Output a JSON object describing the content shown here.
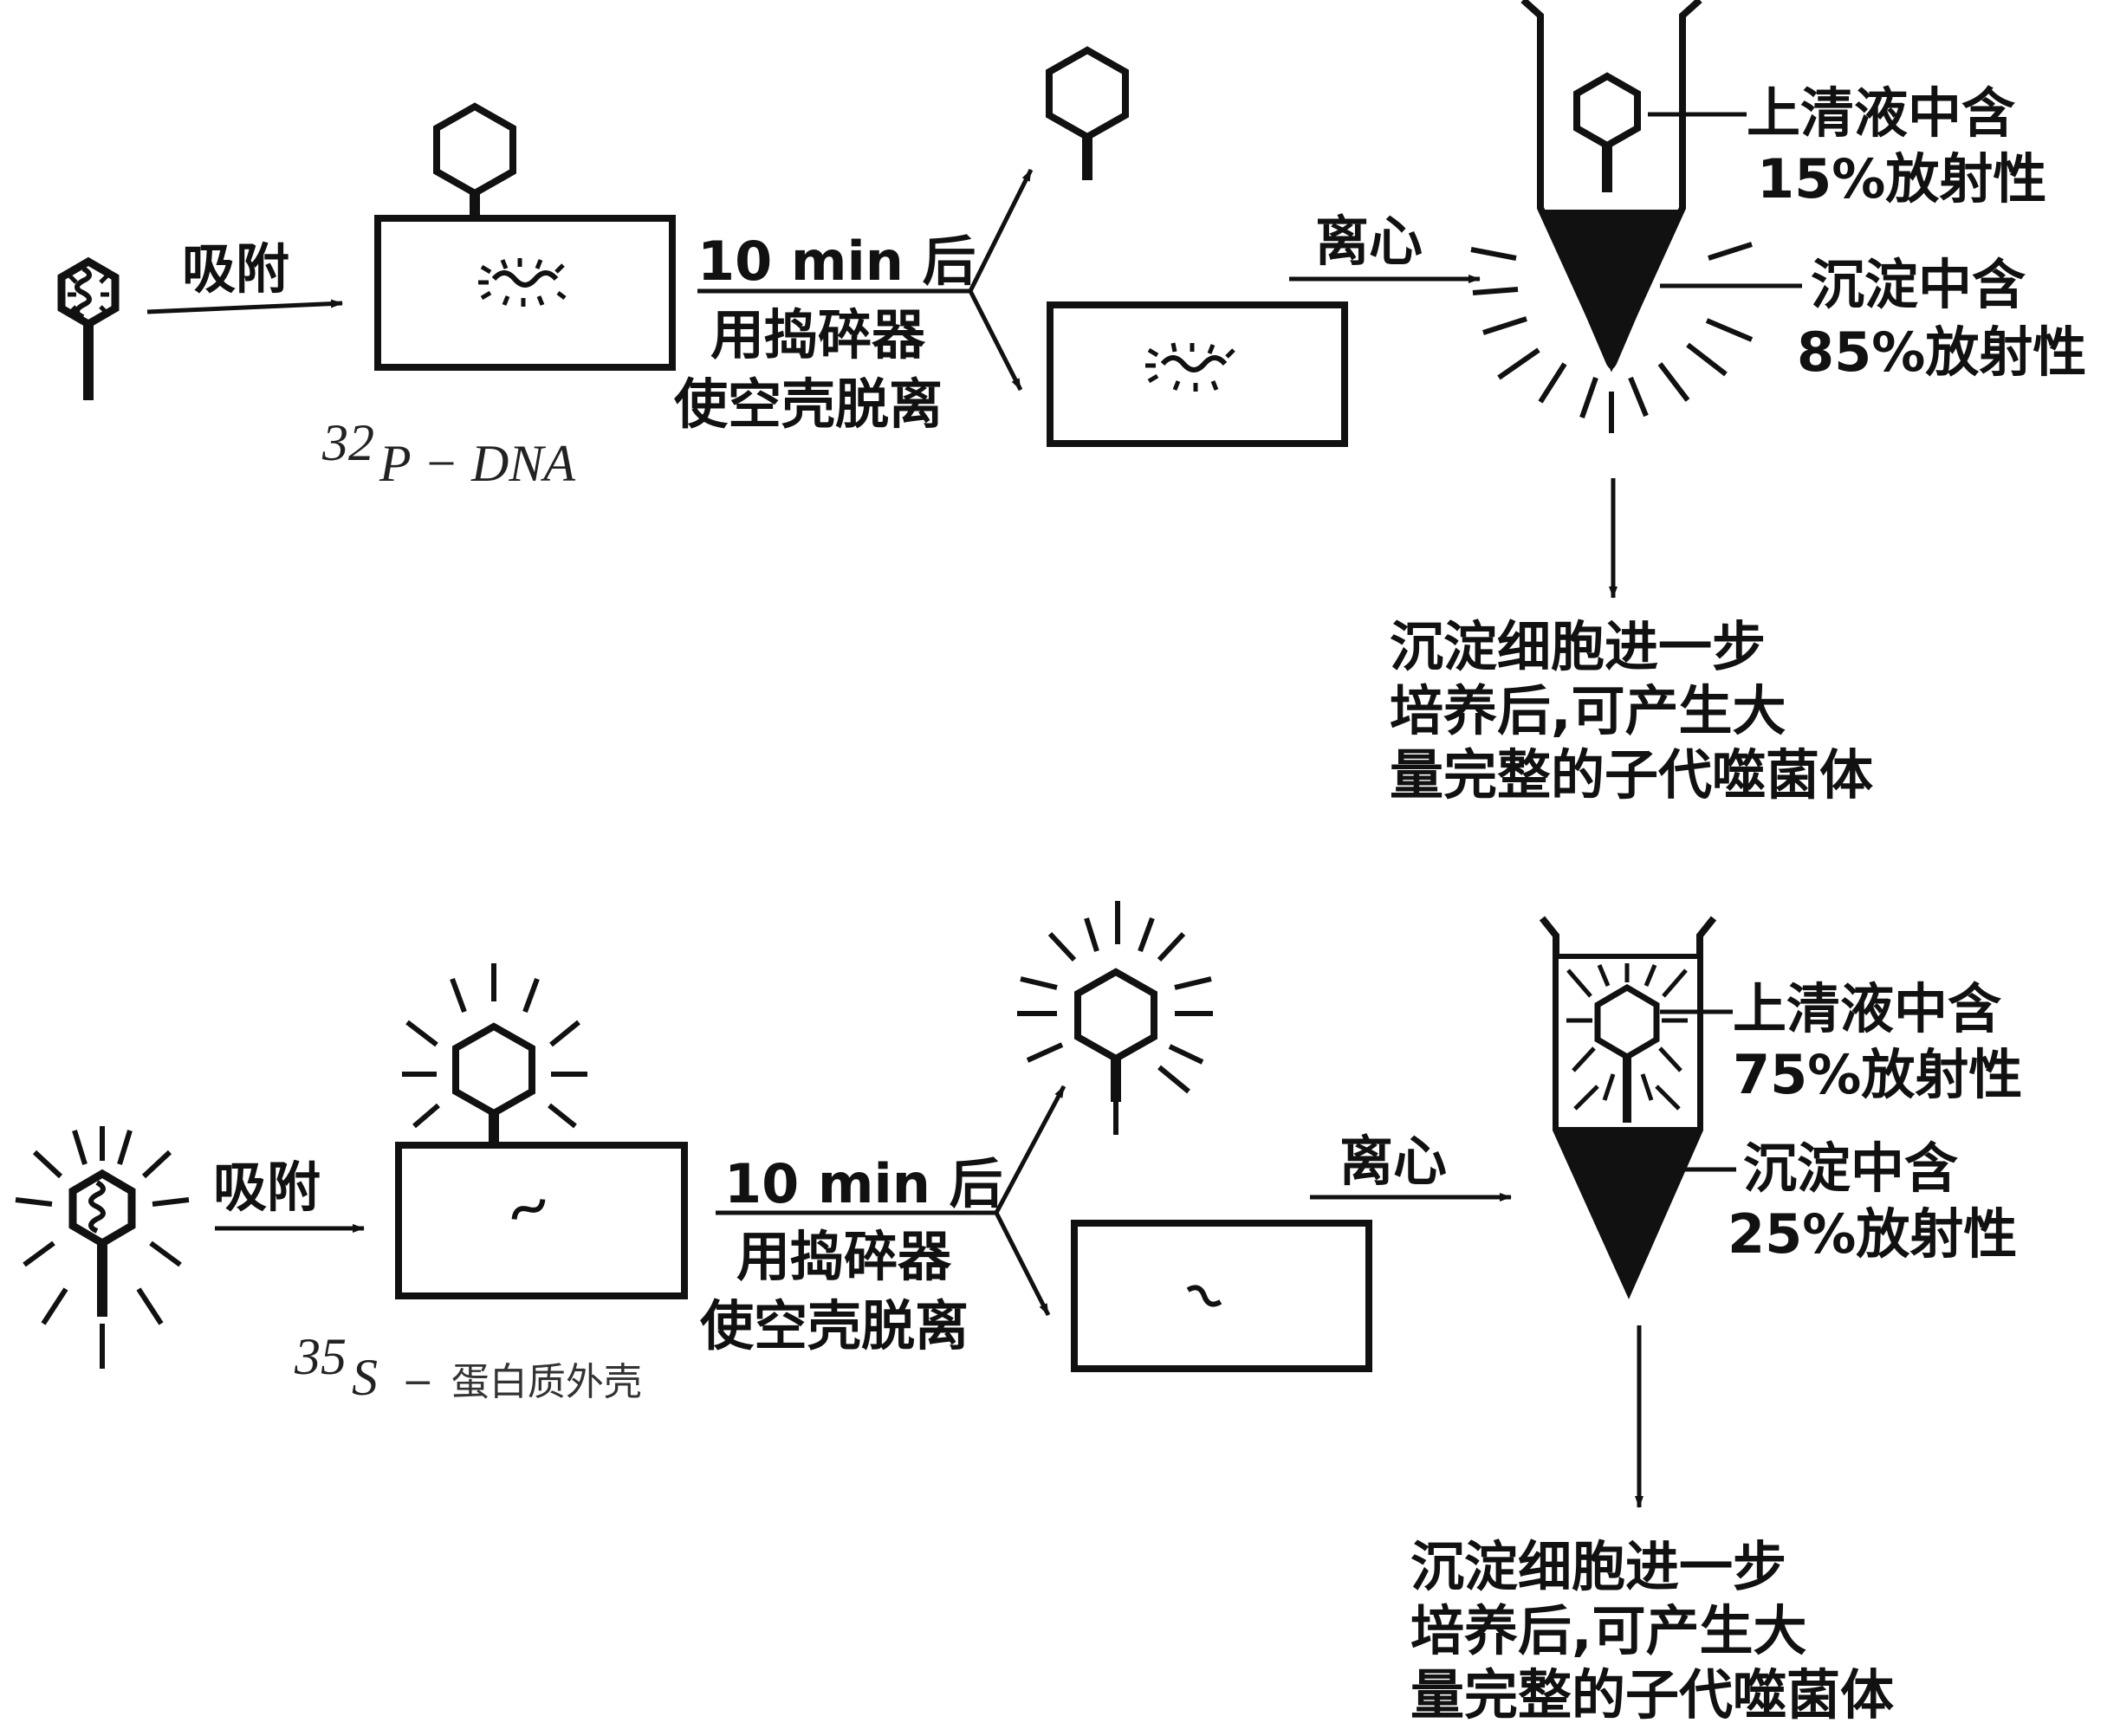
{
  "experiment_dna": {
    "adsorb": "吸附",
    "step_line1": "10 min 后",
    "step_line2": "用捣碎器",
    "step_line3": "使空壳脱离",
    "centrifuge": "离心",
    "supernatant_line1": "上清液中含",
    "supernatant_line2": "15%放射性",
    "pellet_line1": "沉淀中含",
    "pellet_line2": "85%放射性",
    "result_line1": "沉淀细胞进一步",
    "result_line2": "培养后,可产生大",
    "result_line3": "量完整的子代噬菌体",
    "label_sup": "32",
    "label_text": "P − DNA"
  },
  "experiment_protein": {
    "adsorb": "吸附",
    "step_line1": "10 min 后",
    "step_line2": "用捣碎器",
    "step_line3": "使空壳脱离",
    "centrifuge": "离心",
    "supernatant_line1": "上清液中含",
    "supernatant_line2": "75%放射性",
    "pellet_line1": "沉淀中含",
    "pellet_line2": "25%放射性",
    "result_line1": "沉淀细胞进一步",
    "result_line2": "培养后,可产生大",
    "result_line3": "量完整的子代噬菌体",
    "label_sup": "35",
    "label_s": "S",
    "label_text": "蛋白质外壳"
  }
}
